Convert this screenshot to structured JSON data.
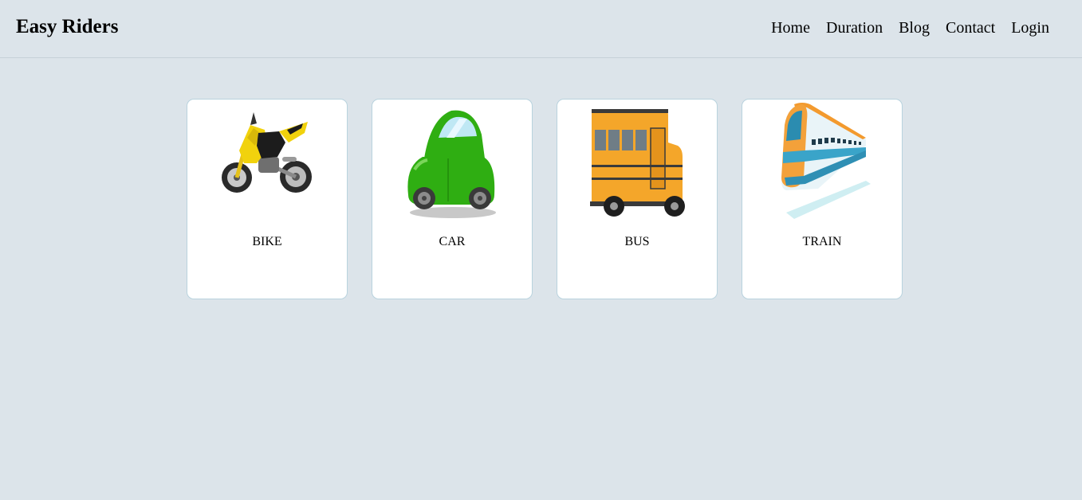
{
  "header": {
    "brand": "Easy Riders",
    "nav": [
      "Home",
      "Duration",
      "Blog",
      "Contact",
      "Login"
    ]
  },
  "cards": [
    {
      "label": "BIKE",
      "icon": "motorcycle-icon"
    },
    {
      "label": "CAR",
      "icon": "car-icon"
    },
    {
      "label": "BUS",
      "icon": "bus-icon"
    },
    {
      "label": "TRAIN",
      "icon": "train-icon"
    }
  ],
  "colors": {
    "background": "#dce4ea",
    "card_background": "#ffffff",
    "card_border": "#b9d3de",
    "bike": "#f1d20d",
    "car": "#2fae12",
    "bus": "#f4a62a",
    "train": "#3aa4c9"
  }
}
